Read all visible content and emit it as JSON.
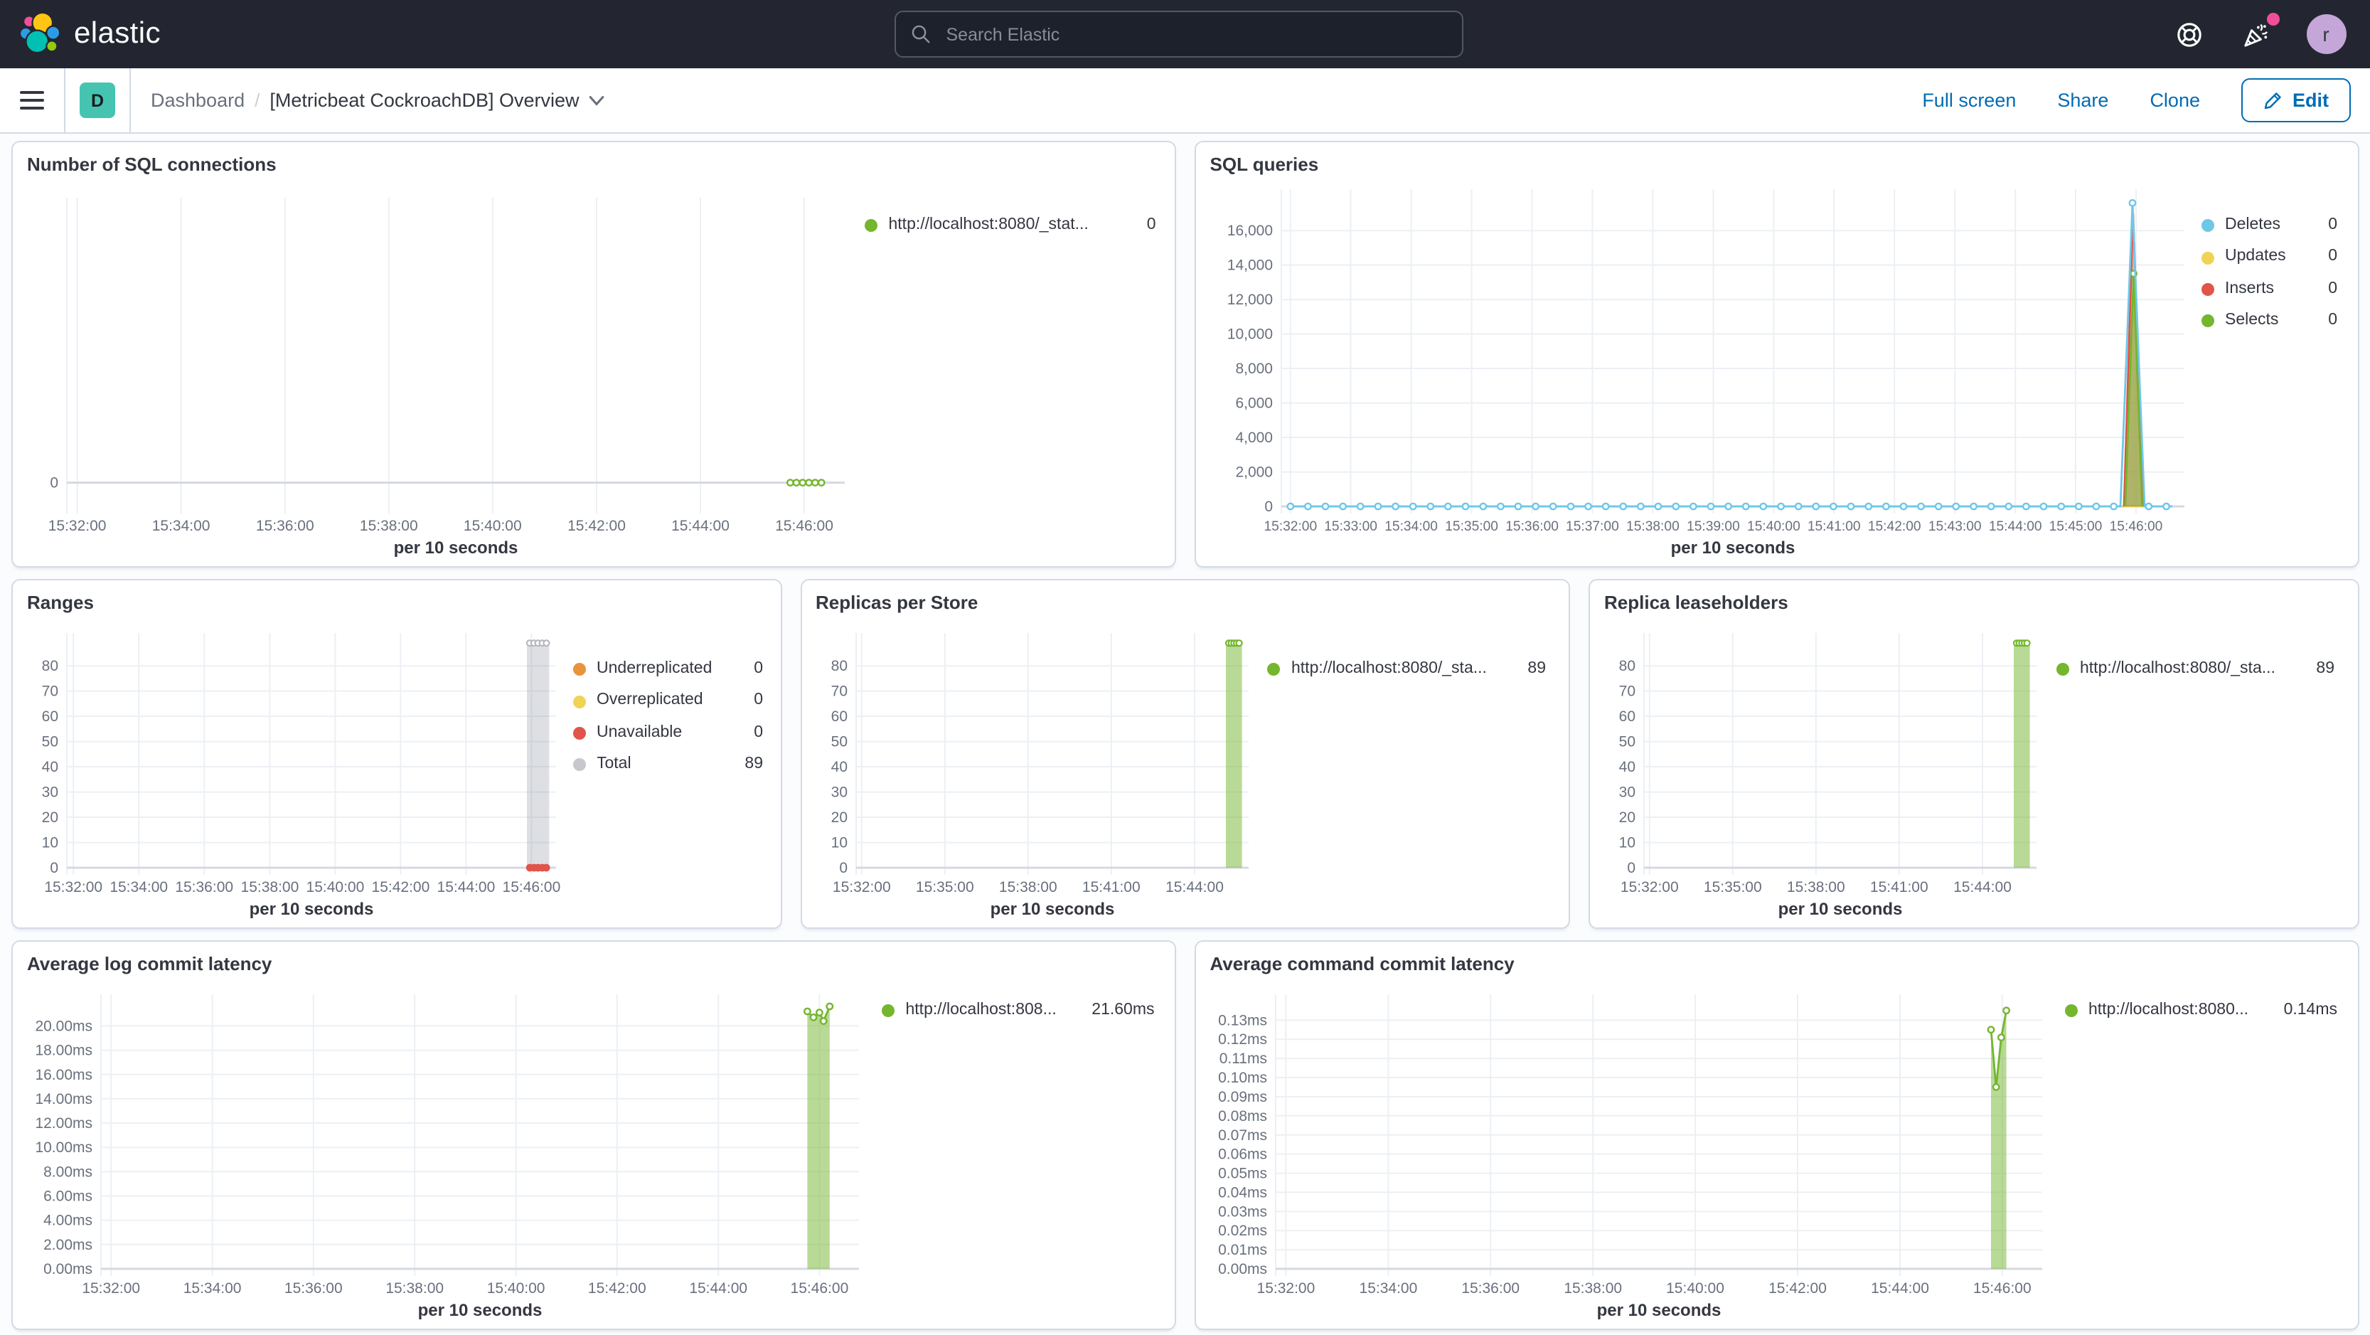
{
  "topnav": {
    "brand": "elastic",
    "search_placeholder": "Search Elastic",
    "avatar_initial": "r"
  },
  "breadcrumbs": {
    "menu_badge": "D",
    "section": "Dashboard",
    "separator": "/",
    "title": "[Metricbeat CockroachDB] Overview"
  },
  "actions": {
    "full_screen": "Full screen",
    "share": "Share",
    "clone": "Clone",
    "edit": "Edit"
  },
  "colors": {
    "topnav_bg": "#232630",
    "accent_blue": "#006bb4",
    "badge_teal": "#45c5b1",
    "avatar_purple": "#c5a6d8",
    "notification_pink": "#f04e98",
    "panel_border": "#d3dae6",
    "green": "#74b62e",
    "sky_blue": "#6fc7e8",
    "yellow": "#f0d354",
    "red": "#e0544a",
    "orange": "#e8943c",
    "gray": "#c6c8cc"
  },
  "chart_data": [
    {
      "id": "sql-connections",
      "type": "line",
      "title": "Number of SQL connections",
      "xlabel": "per 10 seconds",
      "x_domain": [
        1.8,
        16.78
      ],
      "y_domain": [
        -0.5,
        6
      ],
      "x_ticks": [
        {
          "v": 2,
          "label": "15:32:00"
        },
        {
          "v": 4,
          "label": "15:34:00"
        },
        {
          "v": 6,
          "label": "15:36:00"
        },
        {
          "v": 8,
          "label": "15:38:00"
        },
        {
          "v": 10,
          "label": "15:40:00"
        },
        {
          "v": 12,
          "label": "15:42:00"
        },
        {
          "v": 14,
          "label": "15:44:00"
        },
        {
          "v": 16,
          "label": "15:46:00"
        }
      ],
      "y_ticks": [
        {
          "v": 0,
          "label": "0"
        }
      ],
      "series": [
        {
          "name": "http://localhost:8080/_stat...",
          "kind": "line",
          "color": "#74b62e",
          "points": [
            [
              15.73,
              0
            ],
            [
              16.33,
              0
            ]
          ]
        },
        {
          "name": "http://localhost:8080/_stat...",
          "kind": "dots",
          "color": "#74b62e",
          "points": [
            [
              15.73,
              0
            ],
            [
              15.85,
              0
            ],
            [
              15.97,
              0
            ],
            [
              16.09,
              0
            ],
            [
              16.21,
              0
            ],
            [
              16.33,
              0
            ]
          ]
        }
      ],
      "legend": [
        {
          "label": "http://localhost:8080/_stat...",
          "value": "0",
          "color": "#74b62e"
        }
      ]
    },
    {
      "id": "sql-queries",
      "type": "line",
      "title": "SQL queries",
      "xlabel": "per 10 seconds",
      "x_domain": [
        1.85,
        16.8
      ],
      "y_domain": [
        0,
        18400
      ],
      "x_ticks": [
        {
          "v": 2,
          "label": "15:32:00"
        },
        {
          "v": 3,
          "label": "15:33:00"
        },
        {
          "v": 4,
          "label": "15:34:00"
        },
        {
          "v": 5,
          "label": "15:35:00"
        },
        {
          "v": 6,
          "label": "15:36:00"
        },
        {
          "v": 7,
          "label": "15:37:00"
        },
        {
          "v": 8,
          "label": "15:38:00"
        },
        {
          "v": 9,
          "label": "15:39:00"
        },
        {
          "v": 10,
          "label": "15:40:00"
        },
        {
          "v": 11,
          "label": "15:41:00"
        },
        {
          "v": 12,
          "label": "15:42:00"
        },
        {
          "v": 13,
          "label": "15:43:00"
        },
        {
          "v": 14,
          "label": "15:44:00"
        },
        {
          "v": 15,
          "label": "15:45:00"
        },
        {
          "v": 16,
          "label": "15:46:00"
        }
      ],
      "y_ticks": [
        {
          "v": 0,
          "label": "0"
        },
        {
          "v": 2000,
          "label": "2,000"
        },
        {
          "v": 4000,
          "label": "4,000"
        },
        {
          "v": 6000,
          "label": "6,000"
        },
        {
          "v": 8000,
          "label": "8,000"
        },
        {
          "v": 10000,
          "label": "10,000"
        },
        {
          "v": 12000,
          "label": "12,000"
        },
        {
          "v": 14000,
          "label": "14,000"
        },
        {
          "v": 16000,
          "label": "16,000"
        }
      ],
      "series": [
        {
          "name": "Updates",
          "kind": "line",
          "color": "#f0d354",
          "points": [
            [
              2,
              0
            ],
            [
              16.6,
              0
            ]
          ]
        },
        {
          "name": "Inserts",
          "kind": "area",
          "color": "#e0544a",
          "fill": "rgba(224,84,74,0.45)",
          "points": [
            [
              15.8,
              0
            ],
            [
              15.95,
              17000
            ],
            [
              16.12,
              0
            ]
          ]
        },
        {
          "name": "Selects",
          "kind": "area",
          "color": "#74b62e",
          "fill": "rgba(116,182,46,0.55)",
          "points": [
            [
              15.82,
              0
            ],
            [
              15.96,
              13500
            ],
            [
              16.1,
              0
            ]
          ],
          "markers": [
            [
              15.96,
              13500
            ]
          ]
        },
        {
          "name": "Deletes",
          "kind": "line",
          "color": "#6fc7e8",
          "points": [
            [
              1.95,
              0
            ],
            [
              15.74,
              0
            ],
            [
              15.94,
              17600
            ],
            [
              16.14,
              0
            ],
            [
              16.6,
              0
            ]
          ],
          "markers": [
            [
              15.94,
              17600
            ]
          ],
          "marker_gen": {
            "from": 2.0,
            "to": 16.56,
            "step": 0.29,
            "y": 0,
            "skip": [
              15.72,
              16.18
            ]
          }
        }
      ],
      "legend": [
        {
          "label": "Deletes",
          "value": "0",
          "color": "#6fc7e8"
        },
        {
          "label": "Updates",
          "value": "0",
          "color": "#f0d354"
        },
        {
          "label": "Inserts",
          "value": "0",
          "color": "#e0544a"
        },
        {
          "label": "Selects",
          "value": "0",
          "color": "#74b62e"
        }
      ]
    },
    {
      "id": "ranges",
      "type": "bar",
      "title": "Ranges",
      "xlabel": "per 10 seconds",
      "x_domain": [
        1.8,
        16.75
      ],
      "y_domain": [
        0,
        93
      ],
      "x_ticks": [
        {
          "v": 2,
          "label": "15:32:00"
        },
        {
          "v": 4,
          "label": "15:34:00"
        },
        {
          "v": 6,
          "label": "15:36:00"
        },
        {
          "v": 8,
          "label": "15:38:00"
        },
        {
          "v": 10,
          "label": "15:40:00"
        },
        {
          "v": 12,
          "label": "15:42:00"
        },
        {
          "v": 14,
          "label": "15:44:00"
        },
        {
          "v": 16,
          "label": "15:46:00"
        }
      ],
      "y_ticks": [
        {
          "v": 0,
          "label": "0"
        },
        {
          "v": 10,
          "label": "10"
        },
        {
          "v": 20,
          "label": "20"
        },
        {
          "v": 30,
          "label": "30"
        },
        {
          "v": 40,
          "label": "40"
        },
        {
          "v": 50,
          "label": "50"
        },
        {
          "v": 60,
          "label": "60"
        },
        {
          "v": 70,
          "label": "70"
        },
        {
          "v": 80,
          "label": "80"
        }
      ],
      "series": [
        {
          "name": "Total",
          "kind": "bar",
          "color": "#b4b7bd",
          "fill": "rgba(121,128,138,0.25)",
          "x": 16.2,
          "halfw": 0.34,
          "y": 89,
          "topmarkers": 5
        },
        {
          "name": "Unavailable",
          "kind": "dots",
          "color": "#e0544a",
          "solid": true,
          "points": [
            [
              15.95,
              0
            ],
            [
              16.08,
              0
            ],
            [
              16.2,
              0
            ],
            [
              16.33,
              0
            ],
            [
              16.45,
              0
            ]
          ]
        }
      ],
      "legend": [
        {
          "label": "Underreplicated",
          "value": "0",
          "color": "#e8943c"
        },
        {
          "label": "Overreplicated",
          "value": "0",
          "color": "#f0d354"
        },
        {
          "label": "Unavailable",
          "value": "0",
          "color": "#e0544a"
        },
        {
          "label": "Total",
          "value": "89",
          "color": "#c6c8cc"
        }
      ]
    },
    {
      "id": "replicas-per-store",
      "type": "bar",
      "title": "Replicas per Store",
      "xlabel": "per 10 seconds",
      "x_domain": [
        1.8,
        15.95
      ],
      "y_domain": [
        0,
        93
      ],
      "x_ticks": [
        {
          "v": 2,
          "label": "15:32:00"
        },
        {
          "v": 5,
          "label": "15:35:00"
        },
        {
          "v": 8,
          "label": "15:38:00"
        },
        {
          "v": 11,
          "label": "15:41:00"
        },
        {
          "v": 14,
          "label": "15:44:00"
        }
      ],
      "y_ticks": [
        {
          "v": 0,
          "label": "0"
        },
        {
          "v": 10,
          "label": "10"
        },
        {
          "v": 20,
          "label": "20"
        },
        {
          "v": 30,
          "label": "30"
        },
        {
          "v": 40,
          "label": "40"
        },
        {
          "v": 50,
          "label": "50"
        },
        {
          "v": 60,
          "label": "60"
        },
        {
          "v": 70,
          "label": "70"
        },
        {
          "v": 80,
          "label": "80"
        }
      ],
      "series": [
        {
          "name": "http://localhost:8080/_sta...",
          "kind": "bar",
          "color": "#74b62e",
          "fill": "rgba(116,182,46,0.5)",
          "x": 15.42,
          "halfw": 0.29,
          "y": 89,
          "topmarkers": 5
        }
      ],
      "legend": [
        {
          "label": "http://localhost:8080/_sta...",
          "value": "89",
          "color": "#74b62e"
        }
      ]
    },
    {
      "id": "replica-leaseholders",
      "type": "bar",
      "title": "Replica leaseholders",
      "xlabel": "per 10 seconds",
      "x_domain": [
        1.8,
        15.95
      ],
      "y_domain": [
        0,
        93
      ],
      "x_ticks": [
        {
          "v": 2,
          "label": "15:32:00"
        },
        {
          "v": 5,
          "label": "15:35:00"
        },
        {
          "v": 8,
          "label": "15:38:00"
        },
        {
          "v": 11,
          "label": "15:41:00"
        },
        {
          "v": 14,
          "label": "15:44:00"
        }
      ],
      "y_ticks": [
        {
          "v": 0,
          "label": "0"
        },
        {
          "v": 10,
          "label": "10"
        },
        {
          "v": 20,
          "label": "20"
        },
        {
          "v": 30,
          "label": "30"
        },
        {
          "v": 40,
          "label": "40"
        },
        {
          "v": 50,
          "label": "50"
        },
        {
          "v": 60,
          "label": "60"
        },
        {
          "v": 70,
          "label": "70"
        },
        {
          "v": 80,
          "label": "80"
        }
      ],
      "series": [
        {
          "name": "http://localhost:8080/_sta...",
          "kind": "bar",
          "color": "#74b62e",
          "fill": "rgba(116,182,46,0.5)",
          "x": 15.42,
          "halfw": 0.29,
          "y": 89,
          "topmarkers": 5
        }
      ],
      "legend": [
        {
          "label": "http://localhost:8080/_sta...",
          "value": "89",
          "color": "#74b62e"
        }
      ]
    },
    {
      "id": "avg-log-commit-latency",
      "type": "area",
      "title": "Average log commit latency",
      "xlabel": "per 10 seconds",
      "x_domain": [
        1.8,
        16.78
      ],
      "y_domain": [
        0,
        22.6
      ],
      "x_ticks": [
        {
          "v": 2,
          "label": "15:32:00"
        },
        {
          "v": 4,
          "label": "15:34:00"
        },
        {
          "v": 6,
          "label": "15:36:00"
        },
        {
          "v": 8,
          "label": "15:38:00"
        },
        {
          "v": 10,
          "label": "15:40:00"
        },
        {
          "v": 12,
          "label": "15:42:00"
        },
        {
          "v": 14,
          "label": "15:44:00"
        },
        {
          "v": 16,
          "label": "15:46:00"
        }
      ],
      "y_ticks": [
        {
          "v": 0,
          "label": "0.00ms"
        },
        {
          "v": 2,
          "label": "2.00ms"
        },
        {
          "v": 4,
          "label": "4.00ms"
        },
        {
          "v": 6,
          "label": "6.00ms"
        },
        {
          "v": 8,
          "label": "8.00ms"
        },
        {
          "v": 10,
          "label": "10.00ms"
        },
        {
          "v": 12,
          "label": "12.00ms"
        },
        {
          "v": 14,
          "label": "14.00ms"
        },
        {
          "v": 16,
          "label": "16.00ms"
        },
        {
          "v": 18,
          "label": "18.00ms"
        },
        {
          "v": 20,
          "label": "20.00ms"
        }
      ],
      "series": [
        {
          "name": "http://localhost:808...",
          "kind": "area",
          "color": "#74b62e",
          "fill": "rgba(116,182,46,0.5)",
          "points": [
            [
              15.76,
              21.2
            ],
            [
              15.88,
              20.7
            ],
            [
              16.0,
              21.1
            ],
            [
              16.08,
              20.4
            ],
            [
              16.2,
              21.6
            ]
          ],
          "markers": [
            [
              15.76,
              21.2
            ],
            [
              15.88,
              20.7
            ],
            [
              16.0,
              21.1
            ],
            [
              16.08,
              20.4
            ],
            [
              16.2,
              21.6
            ]
          ]
        }
      ],
      "legend": [
        {
          "label": "http://localhost:808...",
          "value": "21.60ms",
          "color": "#74b62e"
        }
      ]
    },
    {
      "id": "avg-command-commit-latency",
      "type": "area",
      "title": "Average command commit latency",
      "xlabel": "per 10 seconds",
      "x_domain": [
        1.8,
        16.78
      ],
      "y_domain": [
        0,
        0.1435
      ],
      "x_ticks": [
        {
          "v": 2,
          "label": "15:32:00"
        },
        {
          "v": 4,
          "label": "15:34:00"
        },
        {
          "v": 6,
          "label": "15:36:00"
        },
        {
          "v": 8,
          "label": "15:38:00"
        },
        {
          "v": 10,
          "label": "15:40:00"
        },
        {
          "v": 12,
          "label": "15:42:00"
        },
        {
          "v": 14,
          "label": "15:44:00"
        },
        {
          "v": 16,
          "label": "15:46:00"
        }
      ],
      "y_ticks": [
        {
          "v": 0,
          "label": "0.00ms"
        },
        {
          "v": 0.01,
          "label": "0.01ms"
        },
        {
          "v": 0.02,
          "label": "0.02ms"
        },
        {
          "v": 0.03,
          "label": "0.03ms"
        },
        {
          "v": 0.04,
          "label": "0.04ms"
        },
        {
          "v": 0.05,
          "label": "0.05ms"
        },
        {
          "v": 0.06,
          "label": "0.06ms"
        },
        {
          "v": 0.07,
          "label": "0.07ms"
        },
        {
          "v": 0.08,
          "label": "0.08ms"
        },
        {
          "v": 0.09,
          "label": "0.09ms"
        },
        {
          "v": 0.1,
          "label": "0.10ms"
        },
        {
          "v": 0.11,
          "label": "0.11ms"
        },
        {
          "v": 0.12,
          "label": "0.12ms"
        },
        {
          "v": 0.13,
          "label": "0.13ms"
        }
      ],
      "series": [
        {
          "name": "http://localhost:8080...",
          "kind": "area",
          "color": "#74b62e",
          "fill": "rgba(116,182,46,0.5)",
          "points": [
            [
              15.78,
              0.125
            ],
            [
              15.88,
              0.095
            ],
            [
              15.98,
              0.121
            ],
            [
              16.08,
              0.135
            ]
          ],
          "markers": [
            [
              15.78,
              0.125
            ],
            [
              15.88,
              0.095
            ],
            [
              15.98,
              0.121
            ],
            [
              16.08,
              0.135
            ]
          ]
        }
      ],
      "legend": [
        {
          "label": "http://localhost:8080...",
          "value": "0.14ms",
          "color": "#74b62e"
        }
      ]
    }
  ]
}
